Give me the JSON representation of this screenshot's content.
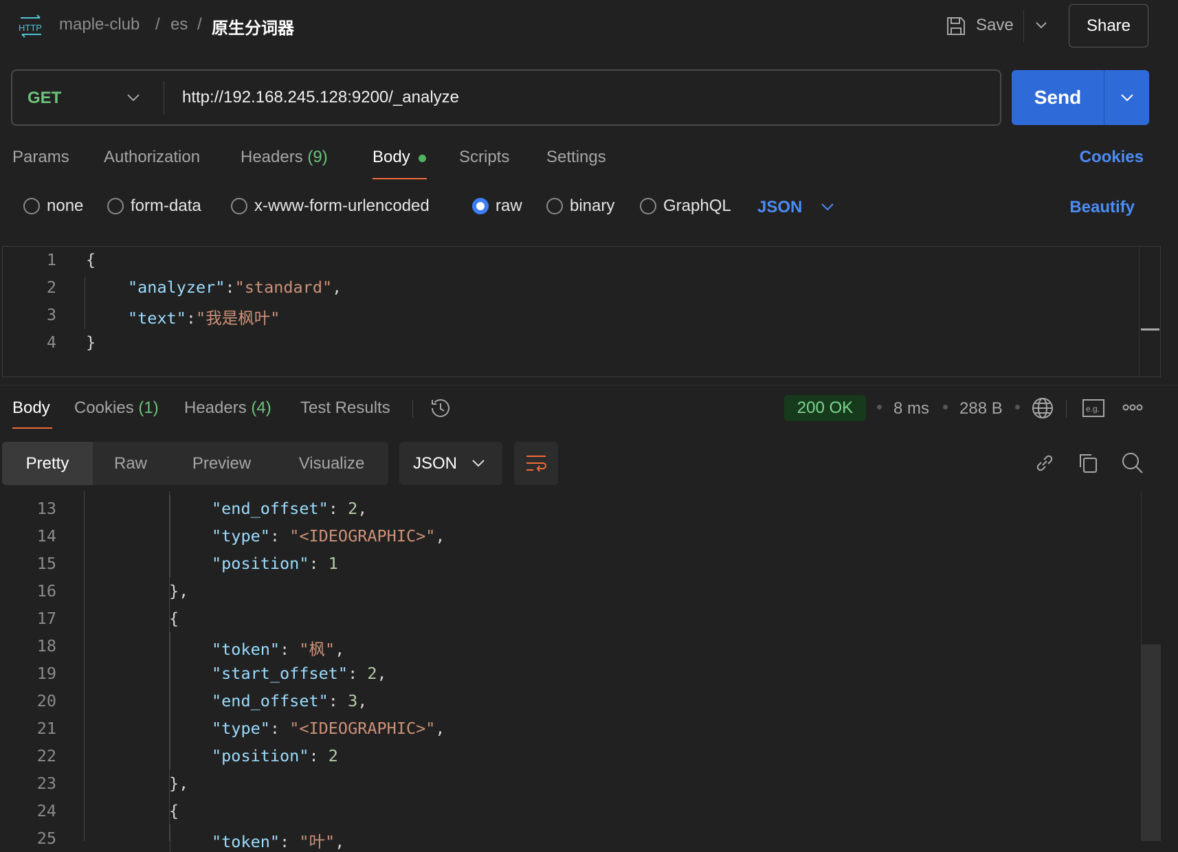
{
  "header": {
    "breadcrumb": [
      "maple-club",
      "es"
    ],
    "separator": "/",
    "title": "原生分词器",
    "save_label": "Save",
    "share_label": "Share"
  },
  "request": {
    "method": "GET",
    "url": "http://192.168.245.128:9200/_analyze",
    "send_label": "Send"
  },
  "tabs": [
    {
      "label": "Params"
    },
    {
      "label": "Authorization"
    },
    {
      "label": "Headers",
      "count": "(9)"
    },
    {
      "label": "Body",
      "active": true
    },
    {
      "label": "Scripts"
    },
    {
      "label": "Settings"
    }
  ],
  "cookies_link": "Cookies",
  "body_types": {
    "options": [
      "none",
      "form-data",
      "x-www-form-urlencoded",
      "raw",
      "binary",
      "GraphQL"
    ],
    "selected": "raw",
    "format": "JSON",
    "beautify": "Beautify"
  },
  "request_body": {
    "lines": [
      {
        "n": "1",
        "text": "{"
      },
      {
        "n": "2",
        "key": "\"analyzer\"",
        "sep": ":",
        "val": "\"standard\"",
        "end": ","
      },
      {
        "n": "3",
        "key": "\"text\"",
        "sep": ":",
        "val": "\"我是枫叶\"",
        "end": ""
      },
      {
        "n": "4",
        "text": "}"
      }
    ]
  },
  "response": {
    "tabs": [
      {
        "label": "Body"
      },
      {
        "label": "Cookies",
        "count": "(1)"
      },
      {
        "label": "Headers",
        "count": "(4)"
      },
      {
        "label": "Test Results"
      }
    ],
    "status": "200 OK",
    "time": "8 ms",
    "size": "288 B",
    "views": [
      "Pretty",
      "Raw",
      "Preview",
      "Visualize"
    ],
    "format": "JSON",
    "colors": {
      "status_bg": "#173a1c",
      "status_fg": "#7bd88f",
      "accent": "#f26b3a",
      "send": "#2f6bd8"
    },
    "lines": [
      {
        "n": "13",
        "ind": 3,
        "key": "\"end_offset\"",
        "val": "2",
        "t": "n",
        "end": ","
      },
      {
        "n": "14",
        "ind": 3,
        "key": "\"type\"",
        "val": "\"<IDEOGRAPHIC>\"",
        "t": "s",
        "end": ","
      },
      {
        "n": "15",
        "ind": 3,
        "key": "\"position\"",
        "val": "1",
        "t": "n",
        "end": ""
      },
      {
        "n": "16",
        "ind": 2,
        "text": "},"
      },
      {
        "n": "17",
        "ind": 2,
        "text": "{"
      },
      {
        "n": "18",
        "ind": 3,
        "key": "\"token\"",
        "val": "\"枫\"",
        "t": "s",
        "end": ","
      },
      {
        "n": "19",
        "ind": 3,
        "key": "\"start_offset\"",
        "val": "2",
        "t": "n",
        "end": ","
      },
      {
        "n": "20",
        "ind": 3,
        "key": "\"end_offset\"",
        "val": "3",
        "t": "n",
        "end": ","
      },
      {
        "n": "21",
        "ind": 3,
        "key": "\"type\"",
        "val": "\"<IDEOGRAPHIC>\"",
        "t": "s",
        "end": ","
      },
      {
        "n": "22",
        "ind": 3,
        "key": "\"position\"",
        "val": "2",
        "t": "n",
        "end": ""
      },
      {
        "n": "23",
        "ind": 2,
        "text": "},"
      },
      {
        "n": "24",
        "ind": 2,
        "text": "{"
      },
      {
        "n": "25",
        "ind": 3,
        "key": "\"token\"",
        "val": "\"叶\"",
        "t": "s",
        "end": ","
      }
    ]
  }
}
